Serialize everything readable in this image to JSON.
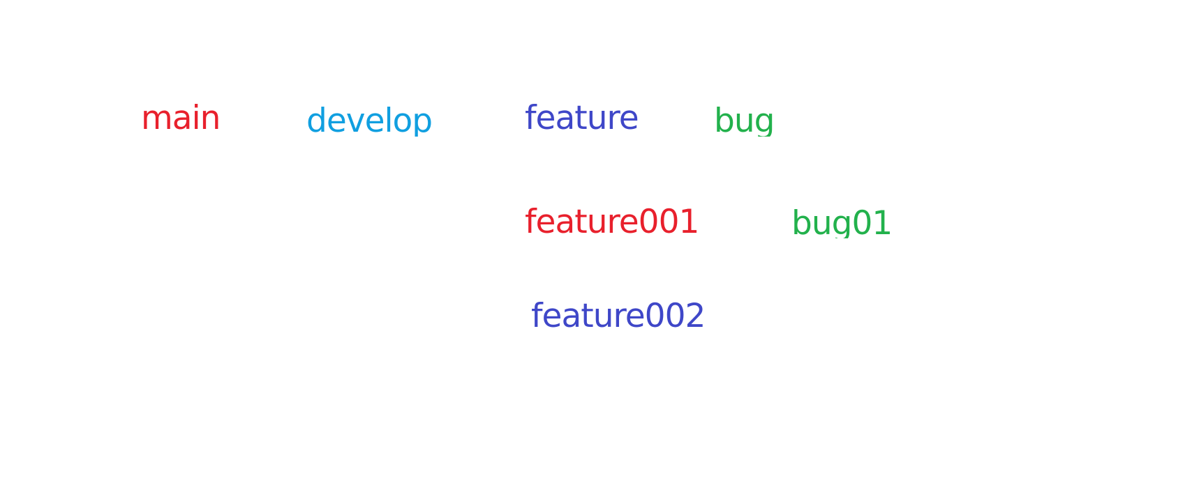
{
  "branches": {
    "main": {
      "label": "main",
      "color": "#e8202c"
    },
    "develop": {
      "label": "develop",
      "color": "#109fe0"
    },
    "feature": {
      "label": "feature",
      "color": "#3f47c8"
    },
    "bug": {
      "label": "bug",
      "color": "#22b14c"
    },
    "feature001": {
      "label": "feature001",
      "color": "#e8202c"
    },
    "bug01": {
      "label": "bug01",
      "color": "#22b14c"
    },
    "feature002": {
      "label": "feature002",
      "color": "#3f47c8"
    }
  }
}
